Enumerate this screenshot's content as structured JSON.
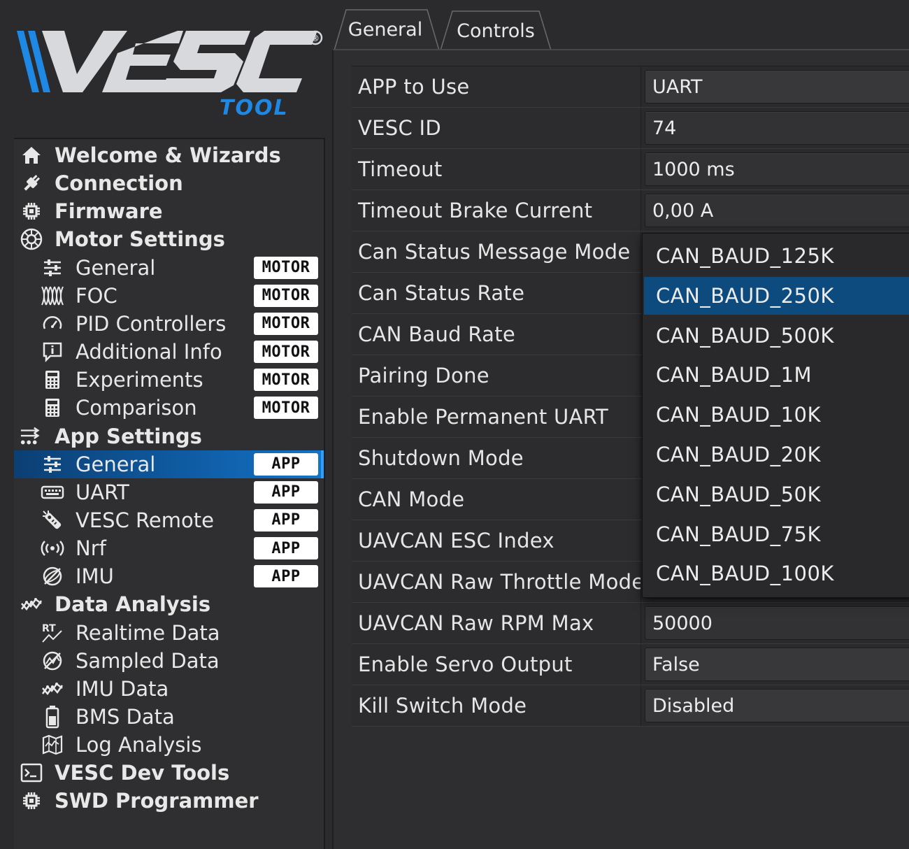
{
  "logo": {
    "wordmark": "VESC",
    "sub": "TOOL",
    "registered": "®"
  },
  "tabs": [
    {
      "label": "General",
      "active": true
    },
    {
      "label": "Controls",
      "active": false
    }
  ],
  "sidebar": {
    "items": [
      {
        "label": "Welcome & Wizards",
        "icon": "home-icon",
        "level": 0
      },
      {
        "label": "Connection",
        "icon": "plug-icon",
        "level": 0
      },
      {
        "label": "Firmware",
        "icon": "chip-icon",
        "level": 0
      },
      {
        "label": "Motor Settings",
        "icon": "motor-icon",
        "level": 0
      },
      {
        "label": "General",
        "icon": "sliders-icon",
        "level": 1,
        "badge": "MOTOR"
      },
      {
        "label": "FOC",
        "icon": "foc-icon",
        "level": 1,
        "badge": "MOTOR"
      },
      {
        "label": "PID Controllers",
        "icon": "gauge-icon",
        "level": 1,
        "badge": "MOTOR"
      },
      {
        "label": "Additional Info",
        "icon": "info-icon",
        "level": 1,
        "badge": "MOTOR"
      },
      {
        "label": "Experiments",
        "icon": "calculator-icon",
        "level": 1,
        "badge": "MOTOR"
      },
      {
        "label": "Comparison",
        "icon": "calculator-icon",
        "level": 1,
        "badge": "MOTOR"
      },
      {
        "label": "App Settings",
        "icon": "app-settings-icon",
        "level": 0
      },
      {
        "label": "General",
        "icon": "sliders-icon",
        "level": 1,
        "badge": "APP",
        "selected": true
      },
      {
        "label": "UART",
        "icon": "keyboard-icon",
        "level": 1,
        "badge": "APP"
      },
      {
        "label": "VESC Remote",
        "icon": "remote-icon",
        "level": 1,
        "badge": "APP"
      },
      {
        "label": "Nrf",
        "icon": "wireless-icon",
        "level": 1,
        "badge": "APP"
      },
      {
        "label": "IMU",
        "icon": "imu-icon",
        "level": 1,
        "badge": "APP"
      },
      {
        "label": "Data Analysis",
        "icon": "analysis-icon",
        "level": 0
      },
      {
        "label": "Realtime Data",
        "icon": "realtime-icon",
        "level": 1
      },
      {
        "label": "Sampled Data",
        "icon": "sampled-icon",
        "level": 1
      },
      {
        "label": "IMU Data",
        "icon": "analysis-icon",
        "level": 1
      },
      {
        "label": "BMS Data",
        "icon": "battery-icon",
        "level": 1
      },
      {
        "label": "Log Analysis",
        "icon": "map-icon",
        "level": 1
      },
      {
        "label": "VESC Dev Tools",
        "icon": "terminal-icon",
        "level": 0
      },
      {
        "label": "SWD Programmer",
        "icon": "chip-icon",
        "level": 0
      }
    ]
  },
  "params": [
    {
      "label": "APP to Use",
      "value": "UART",
      "combo": true
    },
    {
      "label": "VESC ID",
      "value": "74"
    },
    {
      "label": "Timeout",
      "value": "1000 ms"
    },
    {
      "label": "Timeout Brake Current",
      "value": "0,00 A"
    },
    {
      "label": "Can Status Message Mode",
      "value": ""
    },
    {
      "label": "Can Status Rate",
      "value": ""
    },
    {
      "label": "CAN Baud Rate",
      "value": ""
    },
    {
      "label": "Pairing Done",
      "value": ""
    },
    {
      "label": "Enable Permanent UART",
      "value": ""
    },
    {
      "label": "Shutdown Mode",
      "value": ""
    },
    {
      "label": "CAN Mode",
      "value": ""
    },
    {
      "label": "UAVCAN ESC Index",
      "value": ""
    },
    {
      "label": "UAVCAN Raw Throttle Mode",
      "value": ""
    },
    {
      "label": "UAVCAN Raw RPM Max",
      "value": "50000"
    },
    {
      "label": "Enable Servo Output",
      "value": "False",
      "combo": true
    },
    {
      "label": "Kill Switch Mode",
      "value": "Disabled",
      "combo": true
    }
  ],
  "dropdown": {
    "options": [
      "CAN_BAUD_125K",
      "CAN_BAUD_250K",
      "CAN_BAUD_500K",
      "CAN_BAUD_1M",
      "CAN_BAUD_10K",
      "CAN_BAUD_20K",
      "CAN_BAUD_50K",
      "CAN_BAUD_75K",
      "CAN_BAUD_100K"
    ],
    "selected": "CAN_BAUD_250K"
  },
  "colors": {
    "accent": "#1474c6",
    "logo_blue": "#1e88e5",
    "logo_gray": "#d7d9dc",
    "selection": "#0d4a7d"
  }
}
